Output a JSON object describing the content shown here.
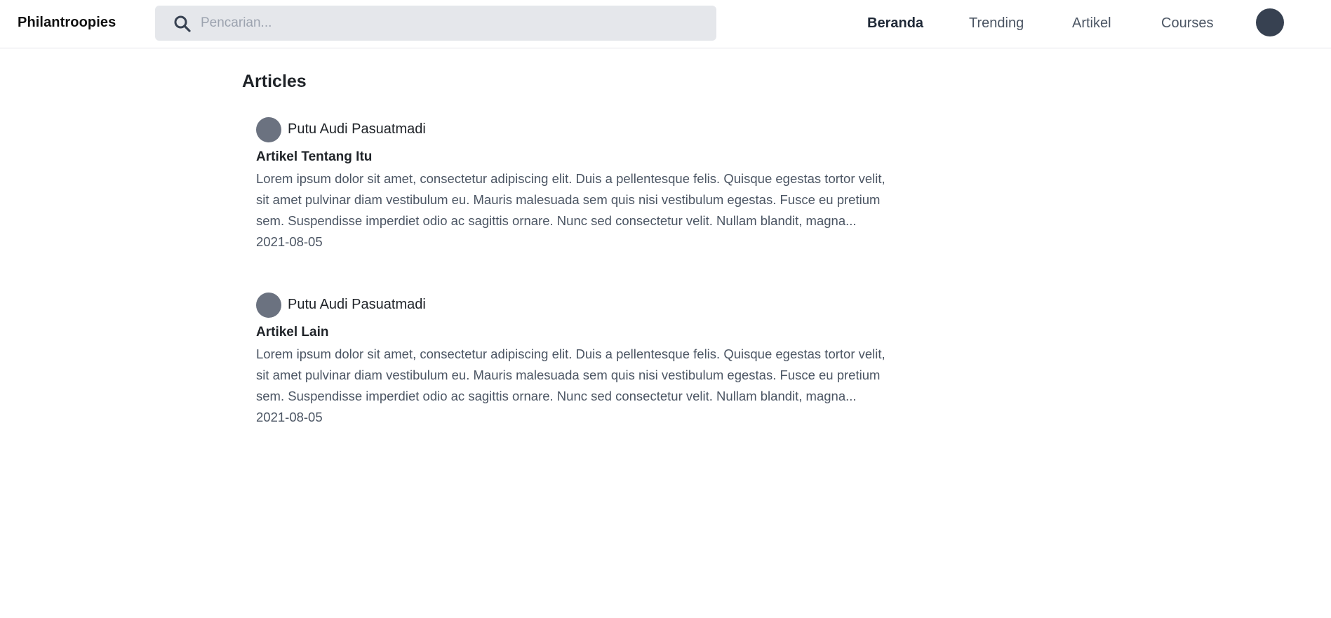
{
  "header": {
    "brand": "Philantroopies",
    "search": {
      "placeholder": "Pencarian..."
    },
    "nav": [
      {
        "label": "Beranda",
        "active": true
      },
      {
        "label": "Trending",
        "active": false
      },
      {
        "label": "Artikel",
        "active": false
      },
      {
        "label": "Courses",
        "active": false
      }
    ]
  },
  "main": {
    "title": "Articles",
    "articles": [
      {
        "author": "Putu Audi Pasuatmadi",
        "title": "Artikel Tentang Itu",
        "excerpt": "Lorem ipsum dolor sit amet, consectetur adipiscing elit. Duis a pellentesque felis. Quisque egestas tortor velit,\nsit amet pulvinar diam vestibulum eu. Mauris malesuada sem quis nisi vestibulum egestas. Fusce eu pretium\nsem. Suspendisse imperdiet odio ac sagittis ornare. Nunc sed consectetur velit. Nullam blandit, magna...",
        "date": "2021-08-05"
      },
      {
        "author": "Putu Audi Pasuatmadi",
        "title": "Artikel Lain",
        "excerpt": "Lorem ipsum dolor sit amet, consectetur adipiscing elit. Duis a pellentesque felis. Quisque egestas tortor velit,\nsit amet pulvinar diam vestibulum eu. Mauris malesuada sem quis nisi vestibulum egestas. Fusce eu pretium\nsem. Suspendisse imperdiet odio ac sagittis ornare. Nunc sed consectetur velit. Nullam blandit, magna...",
        "date": "2021-08-05"
      }
    ]
  },
  "icons": {
    "search": "search-icon",
    "user_avatar": "avatar"
  },
  "colors": {
    "search_bg": "#e5e7eb",
    "avatar_top": "#374151",
    "author_avatar": "#6b7280",
    "text_primary": "#1f2328",
    "text_muted": "#4b5563"
  }
}
